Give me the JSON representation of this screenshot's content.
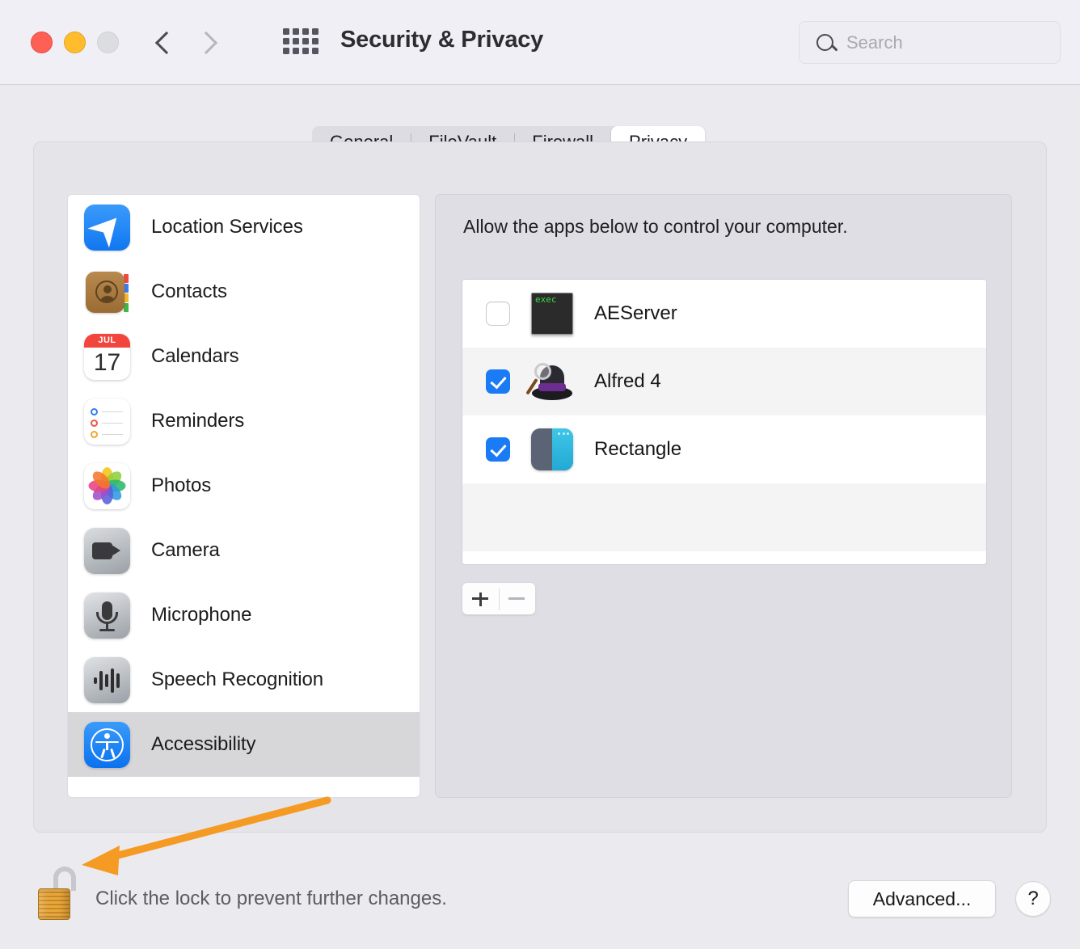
{
  "window": {
    "title": "Security & Privacy",
    "traffic_lights": [
      "close-button",
      "minimize-button",
      "zoom-button"
    ],
    "nav": {
      "back": "back-arrow",
      "forward": "forward-arrow"
    },
    "grid_button": "show-all-icon",
    "colors": {
      "close": "#FF6055",
      "minimize": "#FFBD2E",
      "zoom": "#DCDDE1",
      "toolbar_bg": "#EFEFF5",
      "body_bg": "#EAEAEF",
      "accent_blue": "#1A7BF5",
      "annotation_orange": "#F59A23"
    }
  },
  "search": {
    "placeholder": "Search",
    "value": "",
    "icon": "search-icon"
  },
  "tabs": [
    {
      "label": "General",
      "active": false
    },
    {
      "label": "FileVault",
      "active": false
    },
    {
      "label": "Firewall",
      "active": false
    },
    {
      "label": "Privacy",
      "active": true
    }
  ],
  "sidebar": {
    "items": [
      {
        "label": "Location Services",
        "icon": "location-services-icon",
        "selected": false
      },
      {
        "label": "Contacts",
        "icon": "contacts-icon",
        "selected": false
      },
      {
        "label": "Calendars",
        "icon": "calendars-icon",
        "selected": false,
        "badge_month": "JUL",
        "badge_day": "17"
      },
      {
        "label": "Reminders",
        "icon": "reminders-icon",
        "selected": false
      },
      {
        "label": "Photos",
        "icon": "photos-icon",
        "selected": false
      },
      {
        "label": "Camera",
        "icon": "camera-icon",
        "selected": false
      },
      {
        "label": "Microphone",
        "icon": "microphone-icon",
        "selected": false
      },
      {
        "label": "Speech Recognition",
        "icon": "speech-recognition-icon",
        "selected": false
      },
      {
        "label": "Accessibility",
        "icon": "accessibility-icon",
        "selected": true
      }
    ]
  },
  "detail": {
    "description": "Allow the apps below to control your computer.",
    "apps": [
      {
        "name": "AEServer",
        "checked": false,
        "icon": "aeserver-terminal-icon",
        "icon_text": "exec"
      },
      {
        "name": "Alfred 4",
        "checked": true,
        "icon": "alfred-hat-icon"
      },
      {
        "name": "Rectangle",
        "checked": true,
        "icon": "rectangle-app-icon"
      }
    ],
    "add_button": "+",
    "remove_button": "−"
  },
  "footer": {
    "lock_icon": "unlocked-padlock-icon",
    "lock_text": "Click the lock to prevent further changes.",
    "advanced_label": "Advanced...",
    "help_label": "?"
  },
  "annotation": {
    "type": "arrow",
    "color": "#F59A23",
    "points_to": "unlocked-padlock-icon"
  }
}
